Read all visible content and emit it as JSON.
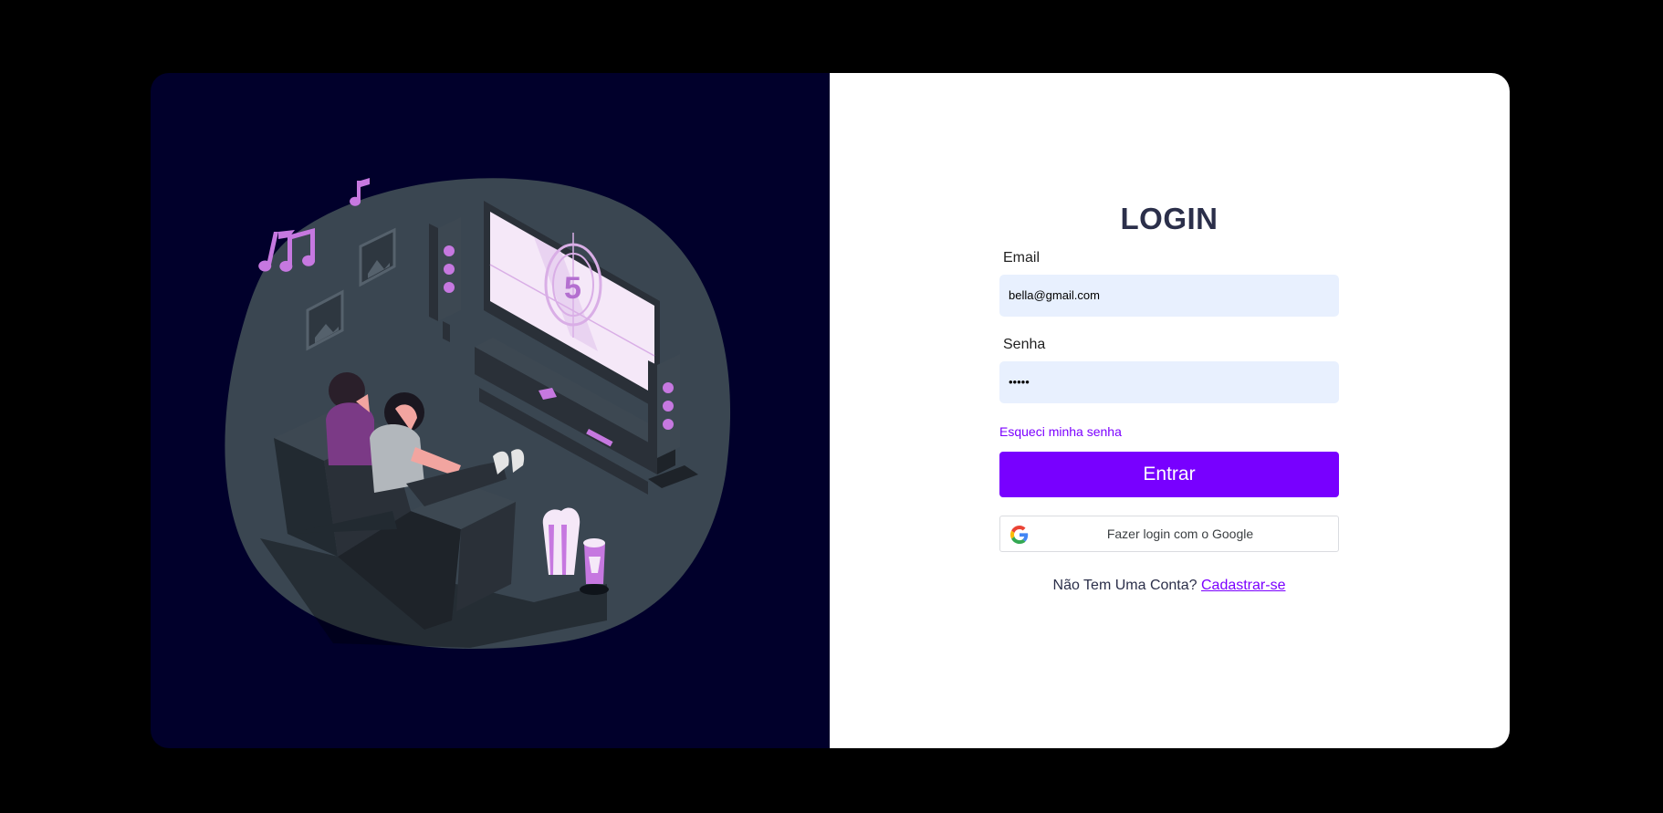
{
  "login": {
    "title": "LOGIN",
    "email_label": "Email",
    "email_value": "bella@gmail.com",
    "password_label": "Senha",
    "password_value": "•••••",
    "forgot_link": "Esqueci minha senha",
    "submit_label": "Entrar",
    "google_label": "Fazer login com o Google",
    "signup_prompt": "Não Tem Uma Conta?",
    "signup_link": "Cadastrar-se"
  },
  "illustration": {
    "tv_countdown": "5",
    "description_icon": "home-theater-illustration"
  },
  "colors": {
    "left_bg": "#01002b",
    "accent": "#7800ff",
    "input_bg": "#e8f0fe",
    "title": "#2b2f4a"
  }
}
